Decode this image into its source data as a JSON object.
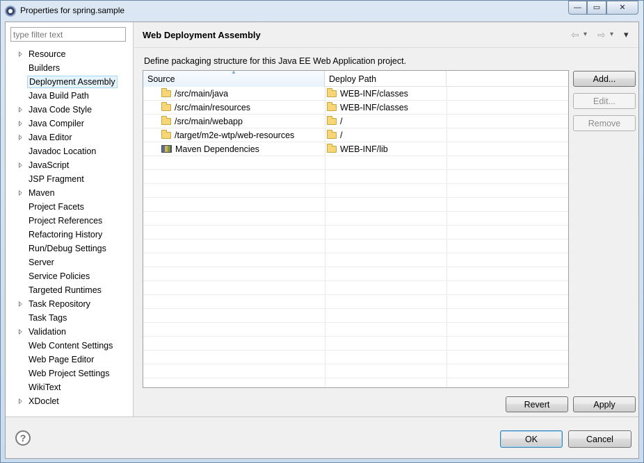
{
  "window": {
    "title": "Properties for spring.sample",
    "controls": {
      "minimize": "—",
      "maximize": "▭",
      "close": "✕"
    }
  },
  "filter": {
    "placeholder": "type filter text"
  },
  "nav": {
    "items": [
      {
        "label": "Resource",
        "expandable": true
      },
      {
        "label": "Builders",
        "expandable": false
      },
      {
        "label": "Deployment Assembly",
        "expandable": false,
        "selected": true
      },
      {
        "label": "Java Build Path",
        "expandable": false
      },
      {
        "label": "Java Code Style",
        "expandable": true
      },
      {
        "label": "Java Compiler",
        "expandable": true
      },
      {
        "label": "Java Editor",
        "expandable": true
      },
      {
        "label": "Javadoc Location",
        "expandable": false
      },
      {
        "label": "JavaScript",
        "expandable": true
      },
      {
        "label": "JSP Fragment",
        "expandable": false
      },
      {
        "label": "Maven",
        "expandable": true
      },
      {
        "label": "Project Facets",
        "expandable": false
      },
      {
        "label": "Project References",
        "expandable": false
      },
      {
        "label": "Refactoring History",
        "expandable": false
      },
      {
        "label": "Run/Debug Settings",
        "expandable": false
      },
      {
        "label": "Server",
        "expandable": false
      },
      {
        "label": "Service Policies",
        "expandable": false
      },
      {
        "label": "Targeted Runtimes",
        "expandable": false
      },
      {
        "label": "Task Repository",
        "expandable": true
      },
      {
        "label": "Task Tags",
        "expandable": false
      },
      {
        "label": "Validation",
        "expandable": true
      },
      {
        "label": "Web Content Settings",
        "expandable": false
      },
      {
        "label": "Web Page Editor",
        "expandable": false
      },
      {
        "label": "Web Project Settings",
        "expandable": false
      },
      {
        "label": "WikiText",
        "expandable": false
      },
      {
        "label": "XDoclet",
        "expandable": true
      }
    ]
  },
  "page": {
    "title": "Web Deployment Assembly",
    "description": "Define packaging structure for this Java EE Web Application project.",
    "nav_arrows": {
      "back": "⇦",
      "forward": "⇨",
      "menu": "▾"
    }
  },
  "table": {
    "columns": [
      "Source",
      "Deploy Path",
      ""
    ],
    "rows": [
      {
        "source": "/src/main/java",
        "source_icon": "folder-icon",
        "deploy": "WEB-INF/classes"
      },
      {
        "source": "/src/main/resources",
        "source_icon": "folder-icon",
        "deploy": "WEB-INF/classes"
      },
      {
        "source": "/src/main/webapp",
        "source_icon": "folder-icon",
        "deploy": "/"
      },
      {
        "source": "/target/m2e-wtp/web-resources",
        "source_icon": "folder-icon",
        "deploy": "/"
      },
      {
        "source": "Maven Dependencies",
        "source_icon": "library-icon",
        "deploy": "WEB-INF/lib"
      }
    ],
    "empty_rows": 16
  },
  "buttons": {
    "add": "Add...",
    "edit": "Edit...",
    "remove": "Remove",
    "revert": "Revert",
    "apply": "Apply",
    "ok": "OK",
    "cancel": "Cancel",
    "help": "?"
  }
}
